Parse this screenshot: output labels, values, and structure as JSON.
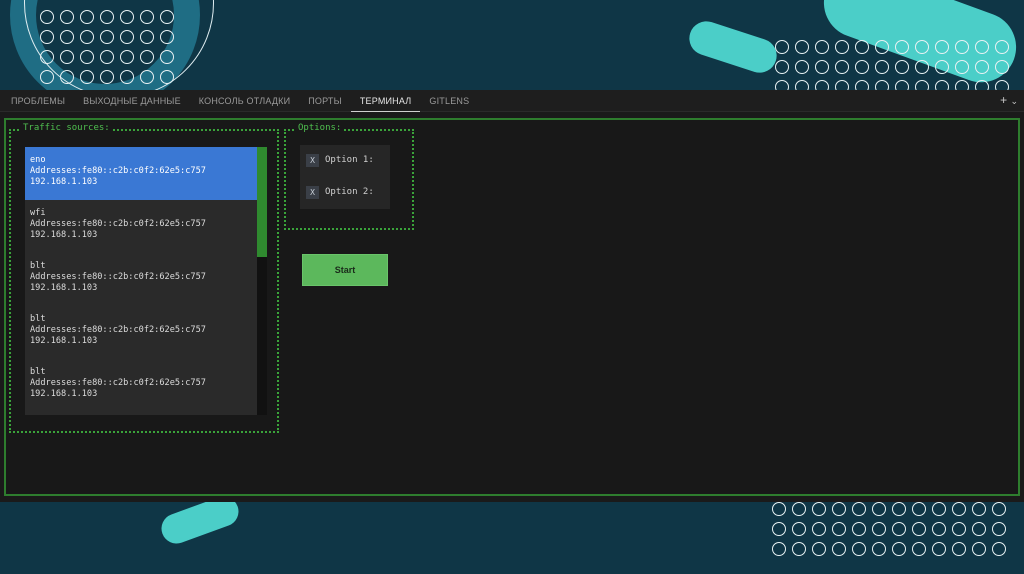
{
  "tabs": [
    {
      "label": "ПРОБЛЕМЫ"
    },
    {
      "label": "ВЫХОДНЫЕ ДАННЫЕ"
    },
    {
      "label": "КОНСОЛЬ ОТЛАДКИ"
    },
    {
      "label": "ПОРТЫ"
    },
    {
      "label": "ТЕРМИНАЛ"
    },
    {
      "label": "GITLENS"
    }
  ],
  "active_tab": "ТЕРМИНАЛ",
  "tab_actions": {
    "add_icon": "plus-icon",
    "add_label": "+",
    "menu_icon": "chevron-down-icon",
    "menu_label": "⌄"
  },
  "traffic_sources": {
    "title": "Traffic sources:",
    "items": [
      {
        "name": "eno",
        "addresses": "Addresses:fe80::c2b:c0f2:62e5:c757",
        "ip": "192.168.1.103",
        "selected": true
      },
      {
        "name": "wfi",
        "addresses": "Addresses:fe80::c2b:c0f2:62e5:c757",
        "ip": "192.168.1.103",
        "selected": false
      },
      {
        "name": "blt",
        "addresses": "Addresses:fe80::c2b:c0f2:62e5:c757",
        "ip": "192.168.1.103",
        "selected": false
      },
      {
        "name": "blt",
        "addresses": "Addresses:fe80::c2b:c0f2:62e5:c757",
        "ip": "192.168.1.103",
        "selected": false
      },
      {
        "name": "blt",
        "addresses": "Addresses:fe80::c2b:c0f2:62e5:c757",
        "ip": "192.168.1.103",
        "selected": false
      }
    ]
  },
  "options": {
    "title": "Options:",
    "items": [
      {
        "mark": "X",
        "label": "Option 1:"
      },
      {
        "mark": "X",
        "label": "Option 2:"
      }
    ]
  },
  "start_label": "Start",
  "colors": {
    "accent_green": "#3aa33a",
    "selected_blue": "#3a78d4",
    "button_green": "#5cb85c",
    "background_teal": "#0f3646"
  }
}
